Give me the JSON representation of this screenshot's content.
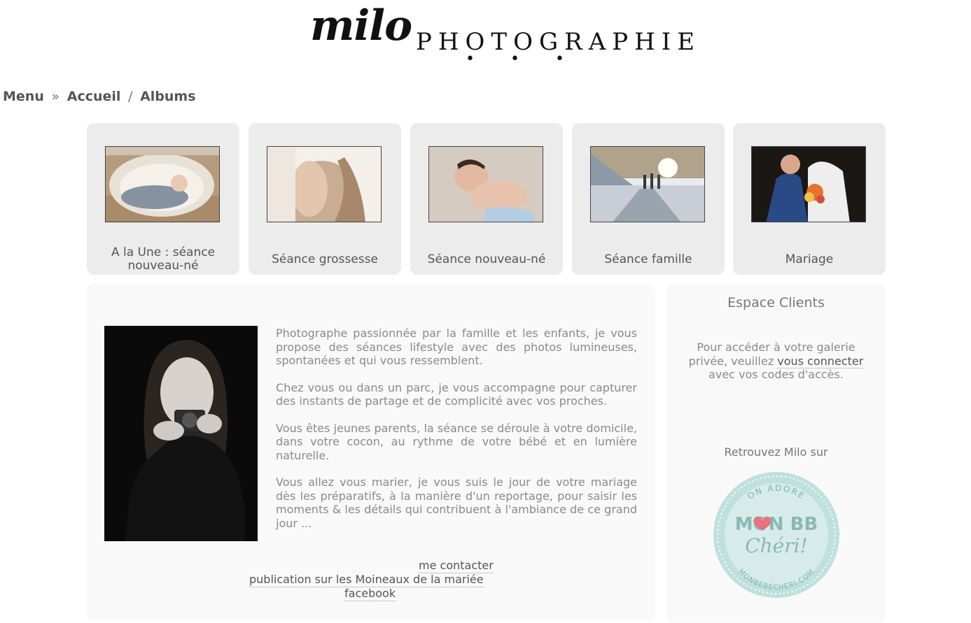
{
  "header": {
    "logo_script": "milo",
    "logo_word": "PHOTOGRAPHIE",
    "logo_dots": "• • •"
  },
  "breadcrumb": {
    "menu": "Menu",
    "separator": "»",
    "home": "Accueil",
    "slash": "/",
    "current": "Albums"
  },
  "albums": [
    {
      "label": "A la Une : séance nouveau-né"
    },
    {
      "label": "Séance grossesse"
    },
    {
      "label": "Séance nouveau-né"
    },
    {
      "label": "Séance famille"
    },
    {
      "label": "Mariage"
    }
  ],
  "intro": {
    "paragraphs": [
      "Photographe passionnée par la famille et les enfants, je vous propose des séances lifestyle avec des photos lumineuses, spontanées et qui vous ressemblent.",
      "Chez vous ou dans un parc, je vous accompagne pour capturer des instants de partage et de complicité avec vos proches.",
      "Vous êtes jeunes parents, la séance se déroule à votre domicile, dans votre cocon, au rythme de votre bébé et en lumière naturelle.",
      "Vous allez vous marier, je vous suis le jour de votre mariage dès les préparatifs, à la manière d'un reportage, pour saisir les moments & les détails qui contribuent à l'ambiance de ce grand jour ..."
    ],
    "links": {
      "contact": "me contacter",
      "publication": "publication sur les Moineaux de la mariée",
      "facebook": "facebook"
    }
  },
  "sidebar": {
    "title": "Espace Clients",
    "login_before": "Pour accéder à votre galerie privée, veuillez ",
    "login_link": "vous connecter",
    "login_after": " avec vos codes d'accès.",
    "follow": "Retrouvez Milo sur",
    "badge": {
      "top": "ON ADORE",
      "main": "MON BB",
      "script": "Chéri!",
      "bottom": "MONBEBECHERI.COM"
    }
  },
  "colors": {
    "album_bg": "#ececec",
    "panel_bg": "#f9f9f9",
    "badge": "#9fd0cc",
    "heart": "#e8737f"
  }
}
